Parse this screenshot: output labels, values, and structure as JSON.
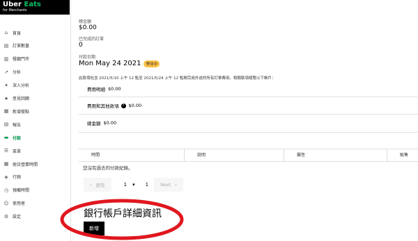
{
  "brand": {
    "title_a": "Uber ",
    "title_b": "Eats",
    "subtitle": "for Merchants",
    "accent": "#06c167"
  },
  "sidebar": {
    "items": [
      {
        "label": "首頁",
        "icon": "home-icon",
        "glyph": "⌂"
      },
      {
        "label": "訂單數量",
        "icon": "orders-icon",
        "glyph": "▤"
      },
      {
        "label": "餐廳門市",
        "icon": "store-icon",
        "glyph": "▥"
      },
      {
        "label": "分析",
        "icon": "chart-icon",
        "glyph": "↗"
      },
      {
        "label": "深入分析",
        "icon": "insights-icon",
        "glyph": "✦"
      },
      {
        "label": "意見回饋",
        "icon": "feedback-icon",
        "glyph": "★"
      },
      {
        "label": "新增餐點",
        "icon": "menu-icon",
        "glyph": "▦"
      },
      {
        "label": "報告",
        "icon": "report-icon",
        "glyph": "▤"
      },
      {
        "label": "付款",
        "icon": "payment-icon",
        "glyph": "▬",
        "active": true
      },
      {
        "label": "菜單",
        "icon": "list-icon",
        "glyph": "☰"
      },
      {
        "label": "假日營業時間",
        "icon": "calendar-icon",
        "glyph": "▦"
      },
      {
        "label": "行銷",
        "icon": "marketing-icon",
        "glyph": "◈"
      },
      {
        "label": "預備時間",
        "icon": "clock-icon",
        "glyph": "◷"
      },
      {
        "label": "使用者",
        "icon": "user-icon",
        "glyph": "☺"
      },
      {
        "label": "設定",
        "icon": "gear-icon",
        "glyph": "⚙"
      }
    ]
  },
  "main": {
    "total_label": "總金額",
    "total_value": "$0.00",
    "completed_label": "已完成的訂單",
    "completed_value": "0",
    "pay_date_label": "付款日期",
    "pay_date_value": "Mon May 24 2021",
    "status_badge": "等待中",
    "notice": "此款項包含 2021/5/10 上午 12 點至 2021/5/24 上午 12 點間完成外送的所有訂單費用。相關款項總覽以下帳戶：",
    "fees": {
      "detail_label": "費用明細",
      "detail_value": "$0.00",
      "other_label": "費用和其他款項",
      "other_value": "$0.00",
      "total_label": "總金額",
      "total_value": "$0.00"
    },
    "table": {
      "headers": [
        "時間",
        "說明",
        "屬性",
        "販售"
      ],
      "empty_message": "您沒有過去的付款紀錄。"
    },
    "pager": {
      "prev_label": "原先",
      "page_value": "1",
      "total_pages": "1",
      "next_label": "Next"
    },
    "bank_title": "銀行帳戶詳細資訊",
    "add_button": "新增"
  }
}
